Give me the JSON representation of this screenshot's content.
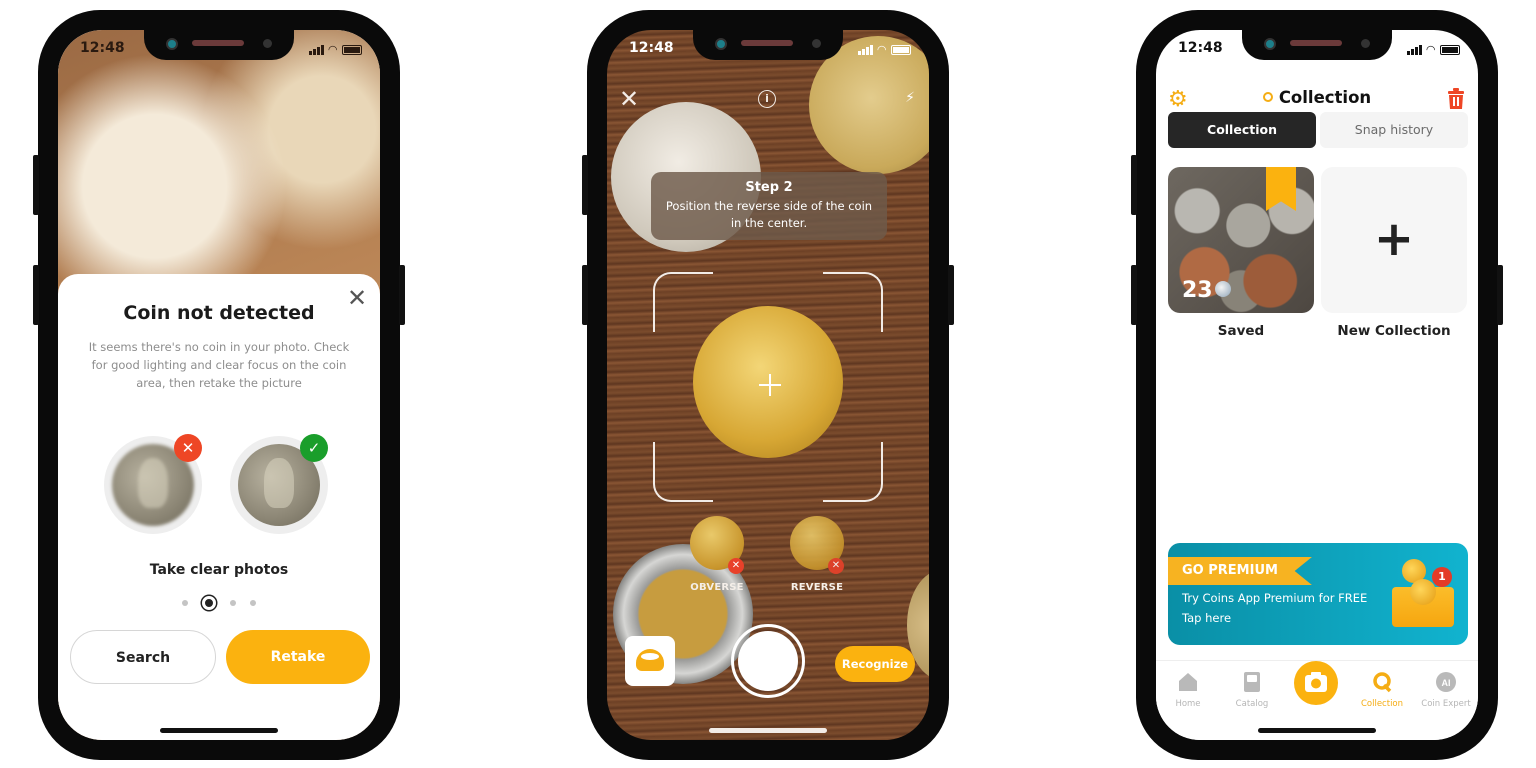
{
  "screens": [
    {
      "id": "coin-not-detected",
      "status": {
        "time": "12:48"
      },
      "dialog": {
        "title": "Coin not detected",
        "description": "It seems there's no coin in your photo. Check for good lighting and clear focus on the coin area, then retake the picture",
        "close_icon": "close-icon",
        "examples": [
          {
            "state": "bad",
            "badge_icon": "x-icon",
            "badge_glyph": "✕",
            "badge_color": "#ee4625"
          },
          {
            "state": "good",
            "badge_icon": "check-icon",
            "badge_glyph": "✓",
            "badge_color": "#1a9e2b"
          }
        ],
        "caption": "Take clear photos",
        "pager": {
          "total": 4,
          "active": 2
        },
        "buttons": {
          "secondary": "Search",
          "primary": "Retake"
        }
      }
    },
    {
      "id": "camera-scan",
      "status": {
        "time": "12:48"
      },
      "toolbar": {
        "close_glyph": "✕",
        "info_glyph": "i",
        "flash_glyph": "⚡"
      },
      "tip": {
        "title": "Step 2",
        "text": "Position the reverse side of the coin in the center."
      },
      "thumbnails": [
        {
          "label": "OBVERSE",
          "remove_glyph": "✕"
        },
        {
          "label": "REVERSE",
          "remove_glyph": "✕"
        }
      ],
      "actions": {
        "recognize": "Recognize"
      }
    },
    {
      "id": "collection",
      "status": {
        "time": "12:48"
      },
      "header": {
        "title": "Collection",
        "settings_glyph": "⚙"
      },
      "segments": [
        {
          "label": "Collection",
          "active": true
        },
        {
          "label": "Snap history",
          "active": false
        }
      ],
      "collections": [
        {
          "label": "Saved",
          "count": "23"
        },
        {
          "label": "New Collection",
          "plus_glyph": "+"
        }
      ],
      "promo": {
        "flag": "GO PREMIUM",
        "line1": "Try Coins App Premium for FREE",
        "line2": "Tap here",
        "notification_count": "1"
      },
      "tabbar": [
        {
          "label": "Home",
          "icon": "home-icon"
        },
        {
          "label": "Catalog",
          "icon": "catalog-icon"
        },
        {
          "label": "",
          "icon": "camera-icon"
        },
        {
          "label": "Collection",
          "icon": "collection-icon",
          "active": true
        },
        {
          "label": "Coin Expert",
          "icon": "ai-icon"
        }
      ]
    }
  ],
  "colors": {
    "accent": "#fbb20f",
    "danger": "#ee4625",
    "success": "#1a9e2b",
    "promo": "#11b3cf"
  }
}
